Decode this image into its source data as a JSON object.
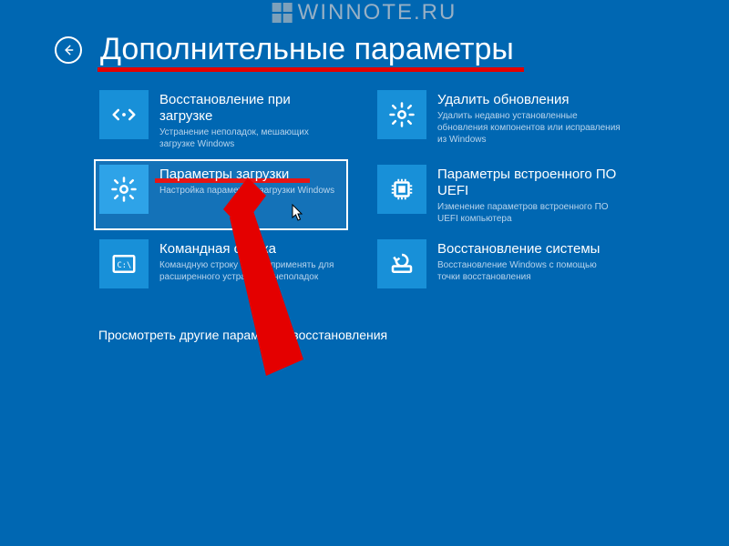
{
  "watermark": {
    "text": "WINNOTE.RU"
  },
  "header": {
    "title": "Дополнительные параметры"
  },
  "tiles": [
    {
      "title": "Восстановление при загрузке",
      "desc": "Устранение неполадок, мешающих загрузке Windows"
    },
    {
      "title": "Удалить обновления",
      "desc": "Удалить недавно установленные обновления компонентов или исправления из Windows"
    },
    {
      "title": "Параметры загрузки",
      "desc": "Настройка параметров загрузки Windows"
    },
    {
      "title": "Параметры встроенного ПО UEFI",
      "desc": "Изменение параметров встроенного ПО UEFI компьютера"
    },
    {
      "title": "Командная строка",
      "desc": "Командную строку можно применять для расширенного устранения неполадок"
    },
    {
      "title": "Восстановление системы",
      "desc": "Восстановление Windows с помощью точки восстановления"
    }
  ],
  "more_link": "Просмотреть другие параметры восстановления"
}
